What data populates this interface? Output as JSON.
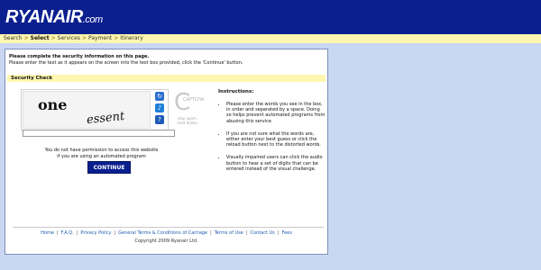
{
  "header": {
    "brand_main": "RYANAIR",
    "brand_suffix": ".com",
    "brand_color": "#0b1f8f"
  },
  "breadcrumb": {
    "items": [
      "Search",
      "Select",
      "Services",
      "Payment",
      "Itinerary"
    ],
    "separator": ">",
    "active_index": 1
  },
  "intro": {
    "heading": "Please complete the security information on this page.",
    "text": "Please enter the text as it appears on the screen into the text box provided, click the 'Continue' button."
  },
  "security": {
    "title": "Security Check",
    "captcha_words": [
      "one",
      "essent"
    ],
    "tools": {
      "reload": "reload-icon",
      "audio": "audio-icon",
      "help": "help-icon"
    },
    "captcha_brand": "CAPTCHA",
    "captcha_tag": "stop spam. read books.",
    "input_value": "",
    "input_placeholder": "",
    "permission_text_line1": "You do not have permission to access this website",
    "permission_text_line2": "if you are using an automated program",
    "continue_label": "CONTINUE"
  },
  "instructions": {
    "title": "Instructions:",
    "items": [
      "Please enter the words you see in the box, in order and separated by a space. Doing so helps prevent automated programs from abusing this service",
      "If you are not sure what the words are, either enter your best guess or click the reload button next to the distorted words.",
      "Visually impaired users can click the audio button to hear a set of digits that can be entered instead of the visual challenge."
    ]
  },
  "footer": {
    "links": [
      "Home",
      "F.A.Q.",
      "Privacy Policy",
      "General Terms & Conditions of Carriage",
      "Terms of Use",
      "Contact Us",
      "Fees"
    ],
    "copyright": "Copyright 2009 Ryanair Ltd."
  }
}
